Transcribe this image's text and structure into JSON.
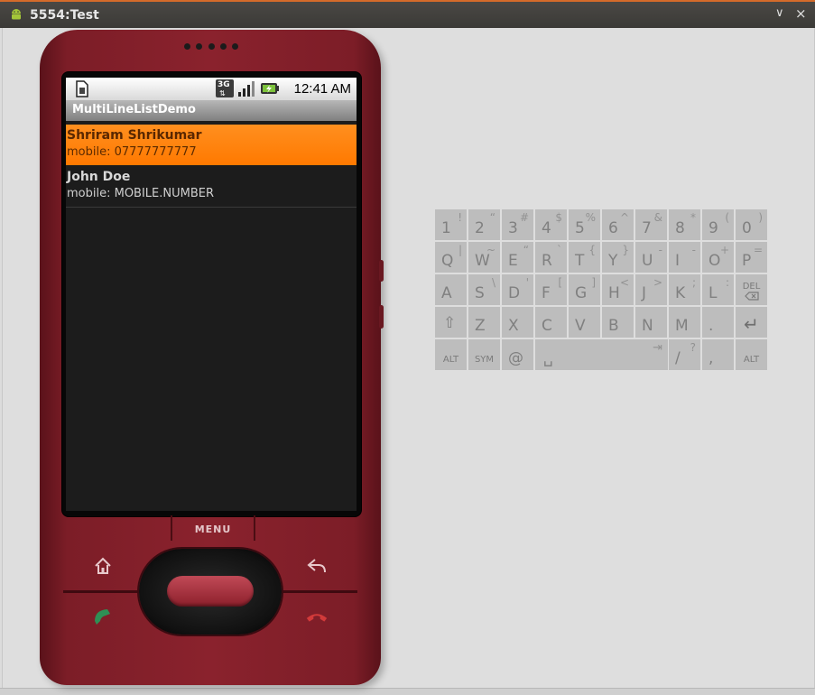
{
  "window": {
    "title": "5554:Test",
    "minimize_glyph": "∨",
    "close_glyph": "×",
    "icon": "android-icon"
  },
  "device": {
    "status_bar": {
      "time": "12:41 AM",
      "icons": [
        "sim-card-icon",
        "3g-icon",
        "signal-icon",
        "battery-charging-icon"
      ],
      "network_label": "3G"
    },
    "app_title": "MultiLineListDemo",
    "contacts": [
      {
        "name": "Shriram Shrikumar",
        "detail": "mobile: 07777777777",
        "selected": true
      },
      {
        "name": "John Doe",
        "detail": "mobile: MOBILE.NUMBER",
        "selected": false
      }
    ],
    "menu_label": "MENU",
    "colors": {
      "selection": "#ff7f00",
      "body": "#7c1d27"
    }
  },
  "keyboard": {
    "rows": [
      [
        {
          "k": "1",
          "s": "!"
        },
        {
          "k": "2",
          "s": "“"
        },
        {
          "k": "3",
          "s": "#"
        },
        {
          "k": "4",
          "s": "$"
        },
        {
          "k": "5",
          "s": "%"
        },
        {
          "k": "6",
          "s": "^"
        },
        {
          "k": "7",
          "s": "&"
        },
        {
          "k": "8",
          "s": "*"
        },
        {
          "k": "9",
          "s": "("
        },
        {
          "k": "0",
          "s": ")"
        }
      ],
      [
        {
          "k": "Q",
          "s": "|"
        },
        {
          "k": "W",
          "s": "~"
        },
        {
          "k": "E",
          "s": "“"
        },
        {
          "k": "R",
          "s": "`"
        },
        {
          "k": "T",
          "s": "{"
        },
        {
          "k": "Y",
          "s": "}"
        },
        {
          "k": "U",
          "s": "-"
        },
        {
          "k": "I",
          "s": "-"
        },
        {
          "k": "O",
          "s": "+"
        },
        {
          "k": "P",
          "s": "="
        }
      ],
      [
        {
          "k": "A",
          "s": ""
        },
        {
          "k": "S",
          "s": "\\"
        },
        {
          "k": "D",
          "s": "'"
        },
        {
          "k": "F",
          "s": "["
        },
        {
          "k": "G",
          "s": "]"
        },
        {
          "k": "H",
          "s": "<"
        },
        {
          "k": "J",
          "s": ">"
        },
        {
          "k": "K",
          "s": ";"
        },
        {
          "k": "L",
          "s": ":"
        },
        {
          "k": "DEL",
          "s": "",
          "special": "del"
        }
      ],
      [
        {
          "k": "⇧",
          "s": "",
          "special": "shift"
        },
        {
          "k": "Z",
          "s": ""
        },
        {
          "k": "X",
          "s": ""
        },
        {
          "k": "C",
          "s": ""
        },
        {
          "k": "V",
          "s": ""
        },
        {
          "k": "B",
          "s": ""
        },
        {
          "k": "N",
          "s": ""
        },
        {
          "k": "M",
          "s": ""
        },
        {
          "k": ".",
          "s": ""
        },
        {
          "k": "↵",
          "s": "",
          "special": "enter"
        }
      ],
      [
        {
          "k": "ALT",
          "s": "",
          "special": "alt"
        },
        {
          "k": "SYM",
          "s": "",
          "special": "sym"
        },
        {
          "k": "@",
          "s": ""
        },
        {
          "k": "␣",
          "s": "⇥",
          "special": "space"
        },
        {
          "k": "/",
          "s": "?"
        },
        {
          "k": ",",
          "s": ""
        },
        {
          "k": "ALT",
          "s": "",
          "special": "alt"
        }
      ]
    ]
  }
}
